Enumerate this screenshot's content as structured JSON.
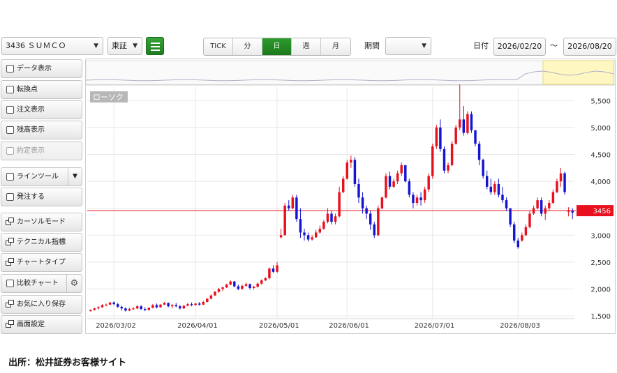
{
  "toolbar": {
    "symbol": "3436 ＳＵＭＣＯ",
    "market": "東証",
    "intervals": [
      {
        "label": "TICK",
        "active": false
      },
      {
        "label": "分",
        "active": false
      },
      {
        "label": "日",
        "active": true
      },
      {
        "label": "週",
        "active": false
      },
      {
        "label": "月",
        "active": false
      }
    ],
    "period_label": "期間",
    "period_value": "",
    "date_label": "日付",
    "date_from": "2026/02/20",
    "tilde": "～",
    "date_to": "2026/08/20"
  },
  "sidebar": {
    "items": [
      {
        "label": "データ表示",
        "type": "checkbox",
        "enabled": true
      },
      {
        "label": "転換点",
        "type": "checkbox",
        "enabled": true
      },
      {
        "label": "注文表示",
        "type": "checkbox",
        "enabled": true
      },
      {
        "label": "残高表示",
        "type": "checkbox",
        "enabled": true
      },
      {
        "label": "約定表示",
        "type": "checkbox",
        "enabled": false
      },
      {
        "label": "ラインツール",
        "type": "checkbox-dropdown",
        "enabled": true
      },
      {
        "label": "発注する",
        "type": "checkbox",
        "enabled": true
      },
      {
        "label": "カーソルモード",
        "type": "window",
        "enabled": true
      },
      {
        "label": "テクニカル指標",
        "type": "window",
        "enabled": true
      },
      {
        "label": "チャートタイプ",
        "type": "window",
        "enabled": true
      },
      {
        "label": "比較チャート",
        "type": "checkbox-gear",
        "enabled": true
      },
      {
        "label": "お気に入り保存",
        "type": "window",
        "enabled": true
      },
      {
        "label": "画面設定",
        "type": "window",
        "enabled": true
      }
    ],
    "icons": {
      "checkbox": "checkbox-icon",
      "window": "window-icon",
      "dropdown": "caret-down-icon",
      "gear": "gear-icon"
    }
  },
  "source_note": "出所：松井証券お客様サイト",
  "chart_data": {
    "type": "candlestick",
    "title": "ローソク",
    "price_axis": {
      "ticks": [
        1500,
        2000,
        2500,
        3000,
        3500,
        4000,
        4500,
        5000,
        5500
      ],
      "ylim": [
        1450,
        5750
      ],
      "position": "right"
    },
    "date_axis": {
      "labels": [
        "2026/03/02",
        "2026/04/01",
        "2026/05/01",
        "2026/06/01",
        "2026/07/01",
        "2026/08/03"
      ],
      "label_index": [
        6,
        27,
        48,
        66,
        88,
        110
      ]
    },
    "current_price": 3456,
    "colors": {
      "up": "#e8101e",
      "down": "#1414d2",
      "current_price_line": "#e8101e",
      "navigator_highlight": "#fff7c2"
    },
    "grid": true,
    "candles": [
      [
        1600,
        1620,
        1580,
        1610
      ],
      [
        1610,
        1650,
        1600,
        1640
      ],
      [
        1640,
        1680,
        1620,
        1660
      ],
      [
        1660,
        1720,
        1650,
        1700
      ],
      [
        1700,
        1730,
        1680,
        1710
      ],
      [
        1710,
        1760,
        1700,
        1750
      ],
      [
        1750,
        1770,
        1700,
        1720
      ],
      [
        1720,
        1740,
        1650,
        1670
      ],
      [
        1670,
        1690,
        1600,
        1640
      ],
      [
        1640,
        1660,
        1580,
        1600
      ],
      [
        1600,
        1650,
        1590,
        1630
      ],
      [
        1630,
        1660,
        1610,
        1640
      ],
      [
        1640,
        1700,
        1630,
        1680
      ],
      [
        1680,
        1700,
        1610,
        1630
      ],
      [
        1630,
        1660,
        1590,
        1610
      ],
      [
        1610,
        1660,
        1600,
        1650
      ],
      [
        1650,
        1720,
        1640,
        1700
      ],
      [
        1700,
        1730,
        1640,
        1660
      ],
      [
        1660,
        1720,
        1650,
        1710
      ],
      [
        1710,
        1760,
        1700,
        1740
      ],
      [
        1740,
        1750,
        1660,
        1680
      ],
      [
        1680,
        1720,
        1640,
        1700
      ],
      [
        1700,
        1740,
        1660,
        1680
      ],
      [
        1680,
        1700,
        1620,
        1640
      ],
      [
        1640,
        1700,
        1630,
        1690
      ],
      [
        1690,
        1740,
        1680,
        1720
      ],
      [
        1720,
        1750,
        1680,
        1700
      ],
      [
        1700,
        1740,
        1690,
        1730
      ],
      [
        1730,
        1760,
        1690,
        1710
      ],
      [
        1710,
        1780,
        1700,
        1760
      ],
      [
        1760,
        1830,
        1750,
        1820
      ],
      [
        1820,
        1900,
        1810,
        1880
      ],
      [
        1880,
        1960,
        1870,
        1950
      ],
      [
        1950,
        2020,
        1930,
        2000
      ],
      [
        2000,
        2040,
        1960,
        2030
      ],
      [
        2030,
        2100,
        2020,
        2080
      ],
      [
        2080,
        2160,
        2070,
        2140
      ],
      [
        2140,
        2150,
        2030,
        2050
      ],
      [
        2050,
        2080,
        1980,
        2000
      ],
      [
        2000,
        2080,
        1990,
        2060
      ],
      [
        2060,
        2120,
        2040,
        2090
      ],
      [
        2090,
        2100,
        1990,
        2020
      ],
      [
        2020,
        2060,
        1990,
        2040
      ],
      [
        2040,
        2120,
        2030,
        2100
      ],
      [
        2100,
        2180,
        2080,
        2160
      ],
      [
        2160,
        2220,
        2150,
        2200
      ],
      [
        2200,
        2400,
        2180,
        2380
      ],
      [
        2380,
        2440,
        2300,
        2320
      ],
      [
        2320,
        2500,
        2300,
        2440
      ],
      [
        2960,
        3120,
        2940,
        3000
      ],
      [
        3000,
        3600,
        2990,
        3550
      ],
      [
        3550,
        3650,
        3450,
        3500
      ],
      [
        3500,
        3750,
        3480,
        3700
      ],
      [
        3700,
        3750,
        3250,
        3300
      ],
      [
        3300,
        3500,
        2950,
        3050
      ],
      [
        3050,
        3120,
        2900,
        3000
      ],
      [
        3000,
        3050,
        2880,
        2920
      ],
      [
        2920,
        3000,
        2900,
        2960
      ],
      [
        2960,
        3100,
        2950,
        3050
      ],
      [
        3050,
        3180,
        3030,
        3120
      ],
      [
        3120,
        3280,
        3100,
        3250
      ],
      [
        3250,
        3500,
        3220,
        3400
      ],
      [
        3400,
        3450,
        3200,
        3250
      ],
      [
        3250,
        3400,
        3200,
        3350
      ],
      [
        3350,
        3900,
        3330,
        3800
      ],
      [
        3800,
        4100,
        3780,
        4050
      ],
      [
        4050,
        4400,
        4030,
        4350
      ],
      [
        4350,
        4480,
        4250,
        4400
      ],
      [
        4400,
        4450,
        3900,
        3950
      ],
      [
        3950,
        4050,
        3600,
        3700
      ],
      [
        3700,
        3800,
        3400,
        3500
      ],
      [
        3500,
        3550,
        3300,
        3400
      ],
      [
        3400,
        3450,
        3100,
        3200
      ],
      [
        3200,
        3250,
        2950,
        3000
      ],
      [
        3000,
        3550,
        2980,
        3500
      ],
      [
        3500,
        3720,
        3480,
        3700
      ],
      [
        3700,
        4150,
        3680,
        4100
      ],
      [
        4100,
        4180,
        3850,
        3900
      ],
      [
        3900,
        4050,
        3880,
        4000
      ],
      [
        4000,
        4200,
        3950,
        4150
      ],
      [
        4150,
        4350,
        4100,
        4300
      ],
      [
        4300,
        4280,
        3980,
        4000
      ],
      [
        4000,
        4050,
        3700,
        3750
      ],
      [
        3750,
        3800,
        3500,
        3600
      ],
      [
        3600,
        3750,
        3550,
        3700
      ],
      [
        3700,
        3800,
        3550,
        3650
      ],
      [
        3650,
        3900,
        3600,
        3850
      ],
      [
        3850,
        4150,
        3800,
        4100
      ],
      [
        4100,
        4700,
        4050,
        4650
      ],
      [
        4650,
        5050,
        4600,
        5000
      ],
      [
        5000,
        5150,
        4550,
        4600
      ],
      [
        4600,
        4650,
        4150,
        4200
      ],
      [
        4200,
        4350,
        4150,
        4300
      ],
      [
        4300,
        4750,
        4280,
        4700
      ],
      [
        4700,
        5050,
        4680,
        5000
      ],
      [
        5000,
        5800,
        4950,
        5150
      ],
      [
        5150,
        5400,
        4850,
        4900
      ],
      [
        4900,
        5300,
        4870,
        5250
      ],
      [
        5250,
        5300,
        4900,
        4950
      ],
      [
        4950,
        4920,
        4650,
        4700
      ],
      [
        4700,
        4750,
        4300,
        4400
      ],
      [
        4400,
        4420,
        4050,
        4100
      ],
      [
        4100,
        4200,
        3850,
        3900
      ],
      [
        3900,
        4050,
        3750,
        3800
      ],
      [
        3800,
        4000,
        3750,
        3950
      ],
      [
        3950,
        4050,
        3700,
        3750
      ],
      [
        3750,
        3900,
        3600,
        3650
      ],
      [
        3650,
        3700,
        3450,
        3500
      ],
      [
        3500,
        3450,
        3150,
        3200
      ],
      [
        3200,
        3250,
        2850,
        2900
      ],
      [
        2900,
        2950,
        2750,
        2780
      ],
      [
        2900,
        3050,
        2880,
        3000
      ],
      [
        3000,
        3200,
        2980,
        3150
      ],
      [
        3150,
        3450,
        3130,
        3400
      ],
      [
        3400,
        3550,
        3380,
        3500
      ],
      [
        3500,
        3700,
        3480,
        3650
      ],
      [
        3650,
        3700,
        3350,
        3400
      ],
      [
        3400,
        3550,
        3280,
        3500
      ],
      [
        3500,
        3650,
        3450,
        3600
      ],
      [
        3600,
        3850,
        3580,
        3800
      ],
      [
        3800,
        4050,
        3780,
        4000
      ],
      [
        4000,
        4250,
        3900,
        4150
      ],
      [
        4150,
        4180,
        3750,
        3800
      ],
      [
        3450,
        3520,
        3350,
        3450
      ],
      [
        3450,
        3500,
        3300,
        3420
      ]
    ]
  }
}
